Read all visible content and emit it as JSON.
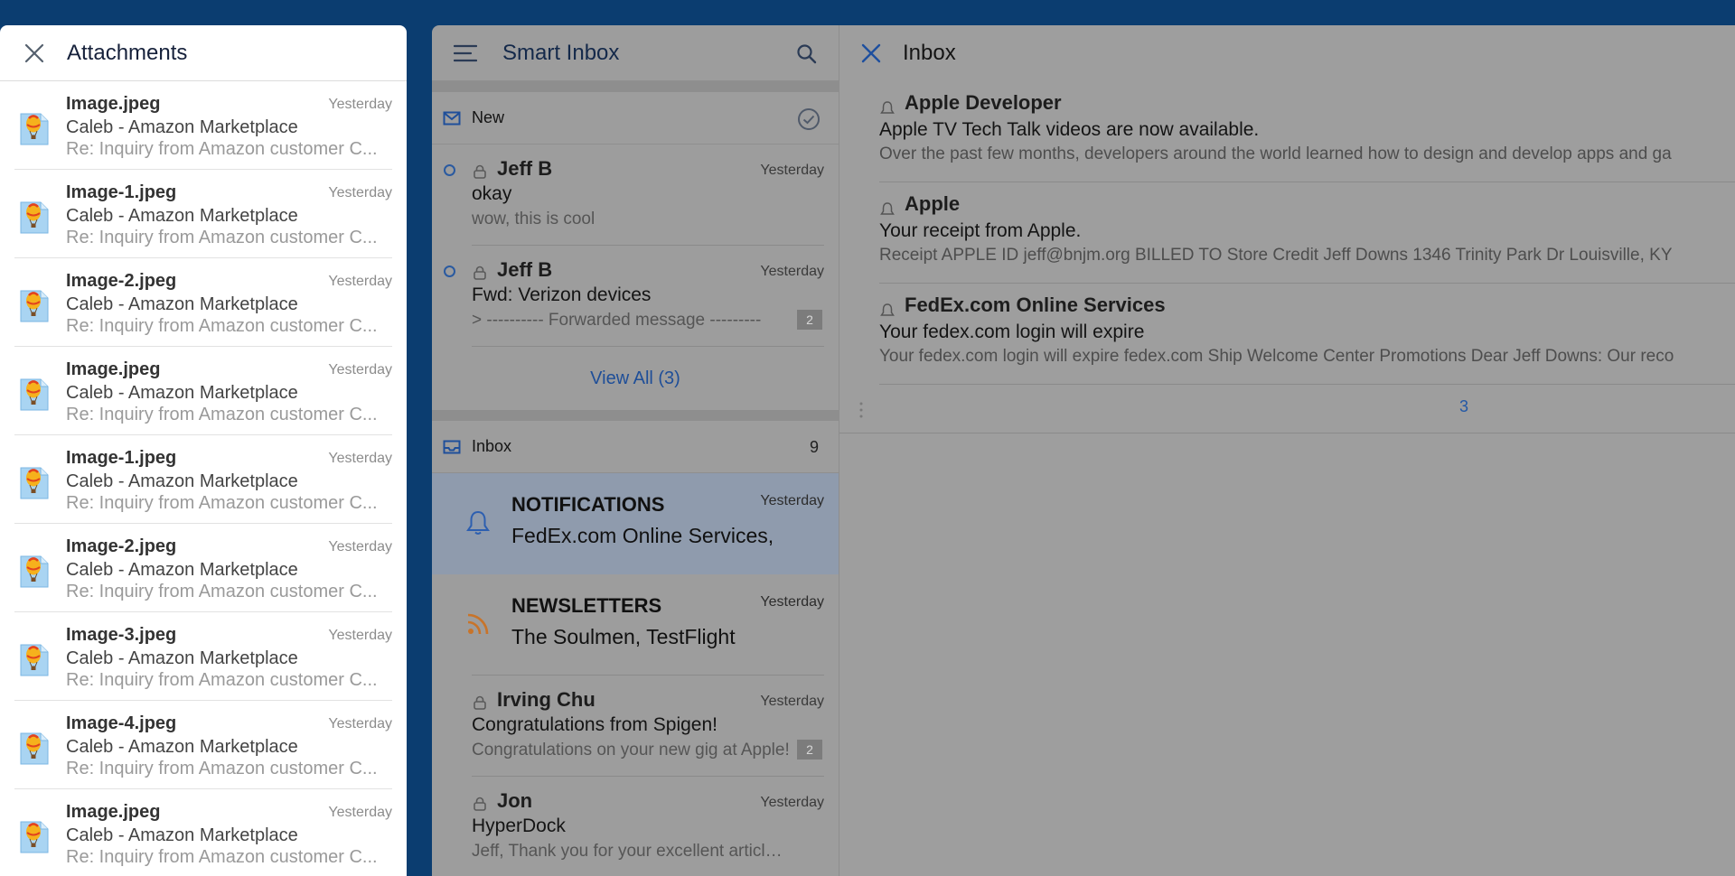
{
  "attachments_panel": {
    "title": "Attachments",
    "items": [
      {
        "name": "Image.jpeg",
        "date": "Yesterday",
        "sender": "Caleb - Amazon Marketplace",
        "subject": "Re: Inquiry from Amazon customer C..."
      },
      {
        "name": "Image-1.jpeg",
        "date": "Yesterday",
        "sender": "Caleb - Amazon Marketplace",
        "subject": "Re: Inquiry from Amazon customer C..."
      },
      {
        "name": "Image-2.jpeg",
        "date": "Yesterday",
        "sender": "Caleb - Amazon Marketplace",
        "subject": "Re: Inquiry from Amazon customer C..."
      },
      {
        "name": "Image.jpeg",
        "date": "Yesterday",
        "sender": "Caleb - Amazon Marketplace",
        "subject": "Re: Inquiry from Amazon customer C..."
      },
      {
        "name": "Image-1.jpeg",
        "date": "Yesterday",
        "sender": "Caleb - Amazon Marketplace",
        "subject": "Re: Inquiry from Amazon customer C..."
      },
      {
        "name": "Image-2.jpeg",
        "date": "Yesterday",
        "sender": "Caleb - Amazon Marketplace",
        "subject": "Re: Inquiry from Amazon customer C..."
      },
      {
        "name": "Image-3.jpeg",
        "date": "Yesterday",
        "sender": "Caleb - Amazon Marketplace",
        "subject": "Re: Inquiry from Amazon customer C..."
      },
      {
        "name": "Image-4.jpeg",
        "date": "Yesterday",
        "sender": "Caleb - Amazon Marketplace",
        "subject": "Re: Inquiry from Amazon customer C..."
      },
      {
        "name": "Image.jpeg",
        "date": "Yesterday",
        "sender": "Caleb - Amazon Marketplace",
        "subject": "Re: Inquiry from Amazon customer C..."
      }
    ]
  },
  "smart_inbox": {
    "title": "Smart Inbox",
    "new_section": {
      "label": "New",
      "messages": [
        {
          "from": "Jeff B",
          "when": "Yesterday",
          "subject": "okay",
          "preview": "wow, this is cool",
          "thread_count": ""
        },
        {
          "from": "Jeff B",
          "when": "Yesterday",
          "subject": "Fwd: Verizon devices",
          "preview": "> ---------- Forwarded message ---------",
          "thread_count": "2"
        }
      ],
      "view_all": "View All (3)"
    },
    "inbox_section": {
      "label": "Inbox",
      "count": "9",
      "groups": [
        {
          "title": "NOTIFICATIONS",
          "when": "Yesterday",
          "subtitle": "FedEx.com Online Services,"
        },
        {
          "title": "NEWSLETTERS",
          "when": "Yesterday",
          "subtitle": "The Soulmen, TestFlight"
        }
      ],
      "messages": [
        {
          "from": "Irving Chu",
          "when": "Yesterday",
          "subject": "Congratulations from Spigen!",
          "preview": "Congratulations on your new gig at Apple!",
          "thread_count": "2"
        },
        {
          "from": "Jon",
          "when": "Yesterday",
          "subject": "HyperDock",
          "preview": "Jeff, Thank you for your excellent articles on the Mac",
          "thread_count": ""
        }
      ]
    }
  },
  "inbox_pane": {
    "title": "Inbox",
    "notifications": [
      {
        "from": "Apple Developer",
        "subject": "Apple TV Tech Talk videos are now available.",
        "preview": "Over the past few months, developers around the world learned how to design and develop apps and ga"
      },
      {
        "from": "Apple",
        "subject": "Your receipt from Apple.",
        "preview": "Receipt APPLE ID jeff@bnjm.org BILLED TO Store Credit Jeff Downs 1346 Trinity Park Dr Louisville, KY"
      },
      {
        "from": "FedEx.com Online Services",
        "subject": "Your fedex.com login will expire",
        "preview": "Your fedex.com login will expire fedex.com Ship Welcome Center Promotions Dear Jeff Downs: Our reco"
      }
    ],
    "page_number": "3"
  },
  "colors": {
    "background_blue": "#0b3d70",
    "accent_blue": "#2358a6",
    "dim_overlay_gray": "#9e9e9e",
    "selected_row": "#8f9bad",
    "newsletter_orange": "#c8742a"
  },
  "icons": {
    "attachments_close": "close-icon",
    "smart_inbox_menu": "hamburger-menu-icon",
    "smart_inbox_search": "search-icon",
    "new_section": "envelope-icon",
    "new_section_action": "check-circle-icon",
    "inbox_section": "inbox-tray-icon",
    "notifications_group": "bell-icon",
    "newsletters_group": "rss-icon",
    "inbox_close": "close-icon",
    "attachment_thumbnail": "balloon-image-icon"
  }
}
